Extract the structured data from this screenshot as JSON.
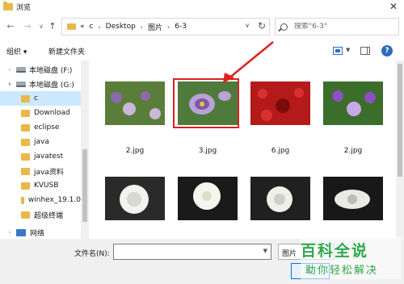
{
  "window": {
    "title": "浏览",
    "close": "✕"
  },
  "nav": {
    "back": "←",
    "forward": "→",
    "dropdown": "∨",
    "up": "↑"
  },
  "address": {
    "chev": "«",
    "crumbs": [
      "c",
      "Desktop",
      "图片",
      "6-3"
    ],
    "sep": "›",
    "drop": "∨",
    "refresh": "↻"
  },
  "search": {
    "placeholder": "搜索\"6-3\""
  },
  "toolbar": {
    "organize": "组织 ▾",
    "new_folder": "新建文件夹",
    "help": "?"
  },
  "sidebar": {
    "items": [
      {
        "label": "本地磁盘 (F:)",
        "kind": "drive",
        "expander": "›"
      },
      {
        "label": "本地磁盘 (G:)",
        "kind": "drive",
        "expander": "∨"
      },
      {
        "label": "c",
        "kind": "folder",
        "selected": true
      },
      {
        "label": "Download",
        "kind": "folder"
      },
      {
        "label": "eclipse",
        "kind": "folder"
      },
      {
        "label": "java",
        "kind": "folder"
      },
      {
        "label": "javatest",
        "kind": "folder"
      },
      {
        "label": "java资料",
        "kind": "folder"
      },
      {
        "label": "KVUSB",
        "kind": "folder"
      },
      {
        "label": "winhex_19.1.0",
        "kind": "folder"
      },
      {
        "label": "超级终端",
        "kind": "folder"
      },
      {
        "label": "网络",
        "kind": "network",
        "expander": "›"
      }
    ]
  },
  "files": {
    "row1": [
      {
        "caption1": "",
        "caption2": "2.jpg",
        "colors": [
          "#5a7d3a",
          "#8a6aa8",
          "#c9b8d8"
        ]
      },
      {
        "caption1": "",
        "caption2": "3.jpg",
        "colors": [
          "#4e7a3c",
          "#b9a2d6",
          "#7d5aa8"
        ],
        "selected": true
      },
      {
        "caption1": "",
        "caption2": "6.jpg",
        "colors": [
          "#b51a1a",
          "#d83030",
          "#7a0c0c"
        ]
      },
      {
        "caption1": "",
        "caption2": "2.jpg",
        "colors": [
          "#3b6e2a",
          "#8e4fc0",
          "#c7a8e8"
        ]
      }
    ],
    "row2": [
      {
        "caption1": "",
        "colors": [
          "#2a2a2a",
          "#f2f2ee",
          "#d8d8d0"
        ]
      },
      {
        "caption1": "",
        "colors": [
          "#1a1a1a",
          "#f5f5f0",
          "#e0dcc8"
        ]
      },
      {
        "caption1": "",
        "colors": [
          "#202020",
          "#f0f0ea",
          "#cfcfc4"
        ]
      },
      {
        "caption1": "",
        "colors": [
          "#181818",
          "#eaeae4",
          "#bdbdb4"
        ]
      }
    ]
  },
  "bottom": {
    "filename_label": "文件名(N):",
    "filetype": "图片",
    "open": "打"
  },
  "watermark": {
    "logo": "百科全说",
    "tagline": "助你轻松解决"
  },
  "colors": {
    "accent": "#0078d7",
    "highlight_red": "#e02020",
    "watermark_green": "#2ea84a",
    "selection_bg": "#cce8ff"
  }
}
